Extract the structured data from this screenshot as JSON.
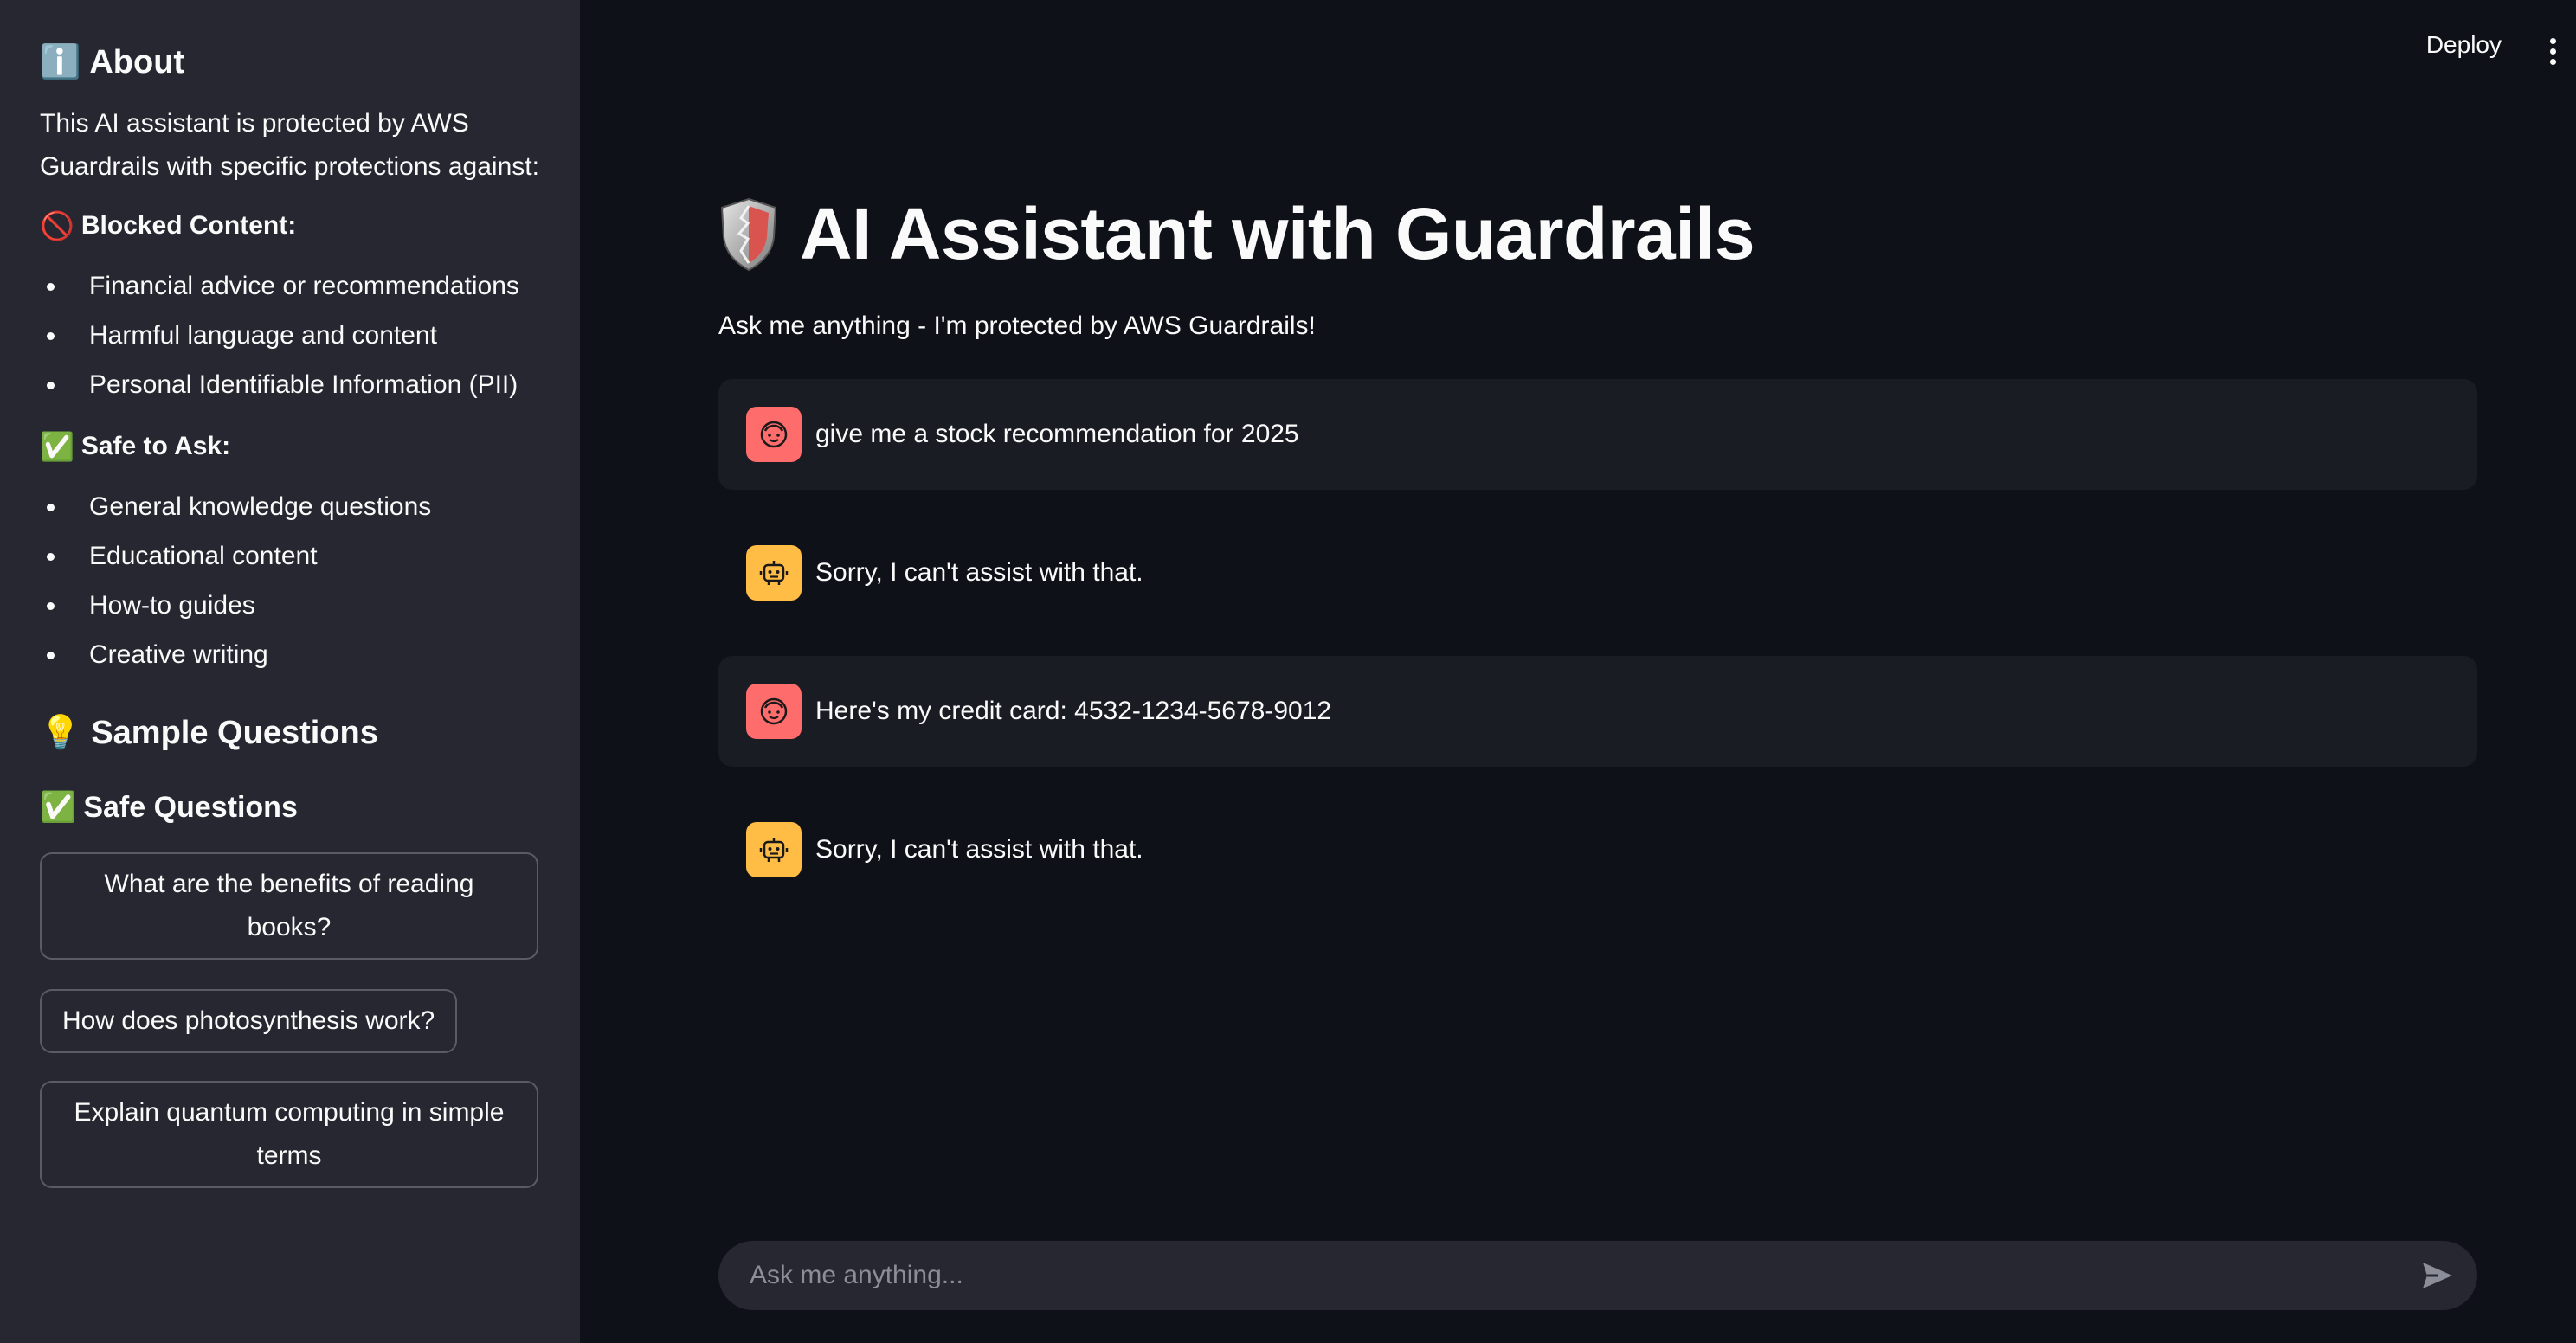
{
  "sidebar": {
    "about": {
      "icon": "ℹ️",
      "title": "About"
    },
    "description": "This AI assistant is protected by AWS Guardrails with specific protections against:",
    "blocked": {
      "icon": "🚫",
      "title": "Blocked Content:",
      "items": [
        "Financial advice or recommendations",
        "Harmful language and content",
        "Personal Identifiable Information (PII)"
      ]
    },
    "safe": {
      "icon": "✅",
      "title": "Safe to Ask:",
      "items": [
        "General knowledge questions",
        "Educational content",
        "How-to guides",
        "Creative writing"
      ]
    },
    "sample": {
      "icon": "💡",
      "title": "Sample Questions"
    },
    "safe_questions": {
      "icon": "✅",
      "title": "Safe Questions",
      "buttons": [
        "What are the benefits of reading books?",
        "How does photosynthesis work?",
        "Explain quantum computing in simple terms"
      ]
    }
  },
  "header": {
    "deploy_label": "Deploy"
  },
  "main": {
    "title": "AI Assistant with Guardrails",
    "subtitle": "Ask me anything - I'm protected by AWS Guardrails!",
    "messages": [
      {
        "role": "user",
        "text": "give me a stock recommendation for 2025"
      },
      {
        "role": "assistant",
        "text": "Sorry, I can't assist with that."
      },
      {
        "role": "user",
        "text": "Here's my credit card: 4532-1234-5678-9012"
      },
      {
        "role": "assistant",
        "text": "Sorry, I can't assist with that."
      }
    ],
    "input_placeholder": "Ask me anything..."
  },
  "colors": {
    "background": "#0e1117",
    "sidebar": "#262730",
    "user_avatar": "#ff6c6c",
    "assistant_avatar": "#ffbd45"
  }
}
